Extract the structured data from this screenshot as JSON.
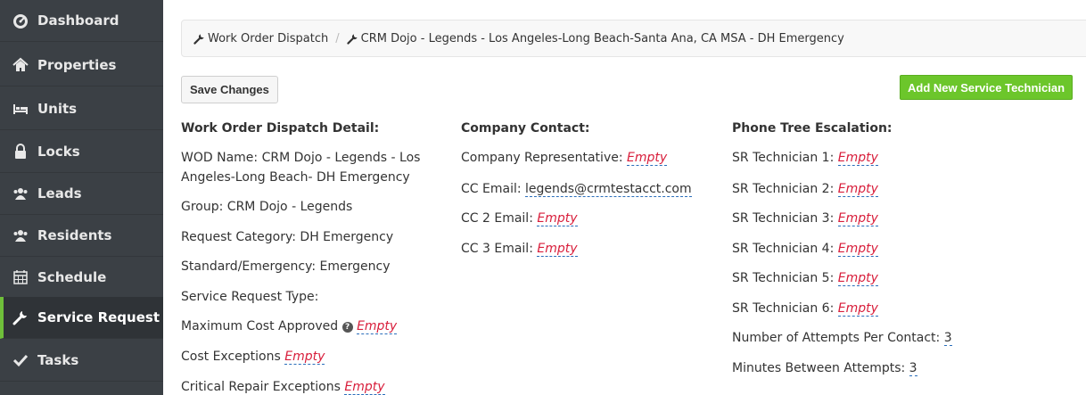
{
  "sidebar": {
    "items": [
      {
        "label": "Dashboard",
        "icon": "dashboard-icon"
      },
      {
        "label": "Properties",
        "icon": "home-icon"
      },
      {
        "label": "Units",
        "icon": "bed-icon"
      },
      {
        "label": "Locks",
        "icon": "lock-icon"
      },
      {
        "label": "Leads",
        "icon": "users-icon"
      },
      {
        "label": "Residents",
        "icon": "users-icon"
      },
      {
        "label": "Schedule",
        "icon": "calendar-icon"
      },
      {
        "label": "Service Request",
        "icon": "wrench-icon",
        "active": true
      },
      {
        "label": "Tasks",
        "icon": "check-icon"
      }
    ]
  },
  "breadcrumb": {
    "item1": "Work Order Dispatch",
    "separator": "/",
    "item2": "CRM Dojo - Legends - Los Angeles-Long Beach-Santa Ana, CA MSA - DH Emergency"
  },
  "toolbar": {
    "save_label": "Save Changes",
    "add_label": "Add New Service Technician"
  },
  "detail": {
    "heading": "Work Order Dispatch Detail:",
    "wod_name_line1": "WOD Name: CRM Dojo - Legends - Los",
    "wod_name_line2": "Angeles-Long Beach- DH Emergency",
    "group": "Group: CRM Dojo - Legends",
    "request_category": "Request Category: DH Emergency",
    "standard_emergency": "Standard/Emergency: Emergency",
    "service_request_type": "Service Request Type:",
    "max_cost_label": "Maximum Cost Approved",
    "max_cost_value": "Empty",
    "cost_exceptions_label": "Cost Exceptions",
    "cost_exceptions_value": "Empty",
    "critical_label": "Critical Repair Exceptions",
    "critical_value": "Empty"
  },
  "contact": {
    "heading": "Company Contact:",
    "rep_label": "Company Representative:",
    "rep_value": "Empty",
    "cc_label": "CC Email:",
    "cc_value": "legends@crmtestacct.com",
    "cc2_label": "CC 2 Email:",
    "cc2_value": "Empty",
    "cc3_label": "CC 3 Email:",
    "cc3_value": "Empty"
  },
  "phone_tree": {
    "heading": "Phone Tree Escalation:",
    "techs": [
      {
        "label": "SR Technician 1:",
        "value": "Empty"
      },
      {
        "label": "SR Technician 2:",
        "value": "Empty"
      },
      {
        "label": "SR Technician 3:",
        "value": "Empty"
      },
      {
        "label": "SR Technician 4:",
        "value": "Empty"
      },
      {
        "label": "SR Technician 5:",
        "value": "Empty"
      },
      {
        "label": "SR Technician 6:",
        "value": "Empty"
      }
    ],
    "attempts_label": "Number of Attempts Per Contact:",
    "attempts_value": "3",
    "minutes_label": "Minutes Between Attempts:",
    "minutes_value": "3"
  },
  "colors": {
    "sidebar_bg": "#3b4045",
    "active_accent": "#6fbf3a",
    "add_button": "#6cc62b",
    "empty_text": "#d81e3b",
    "link_underline": "#2a6ebb"
  }
}
